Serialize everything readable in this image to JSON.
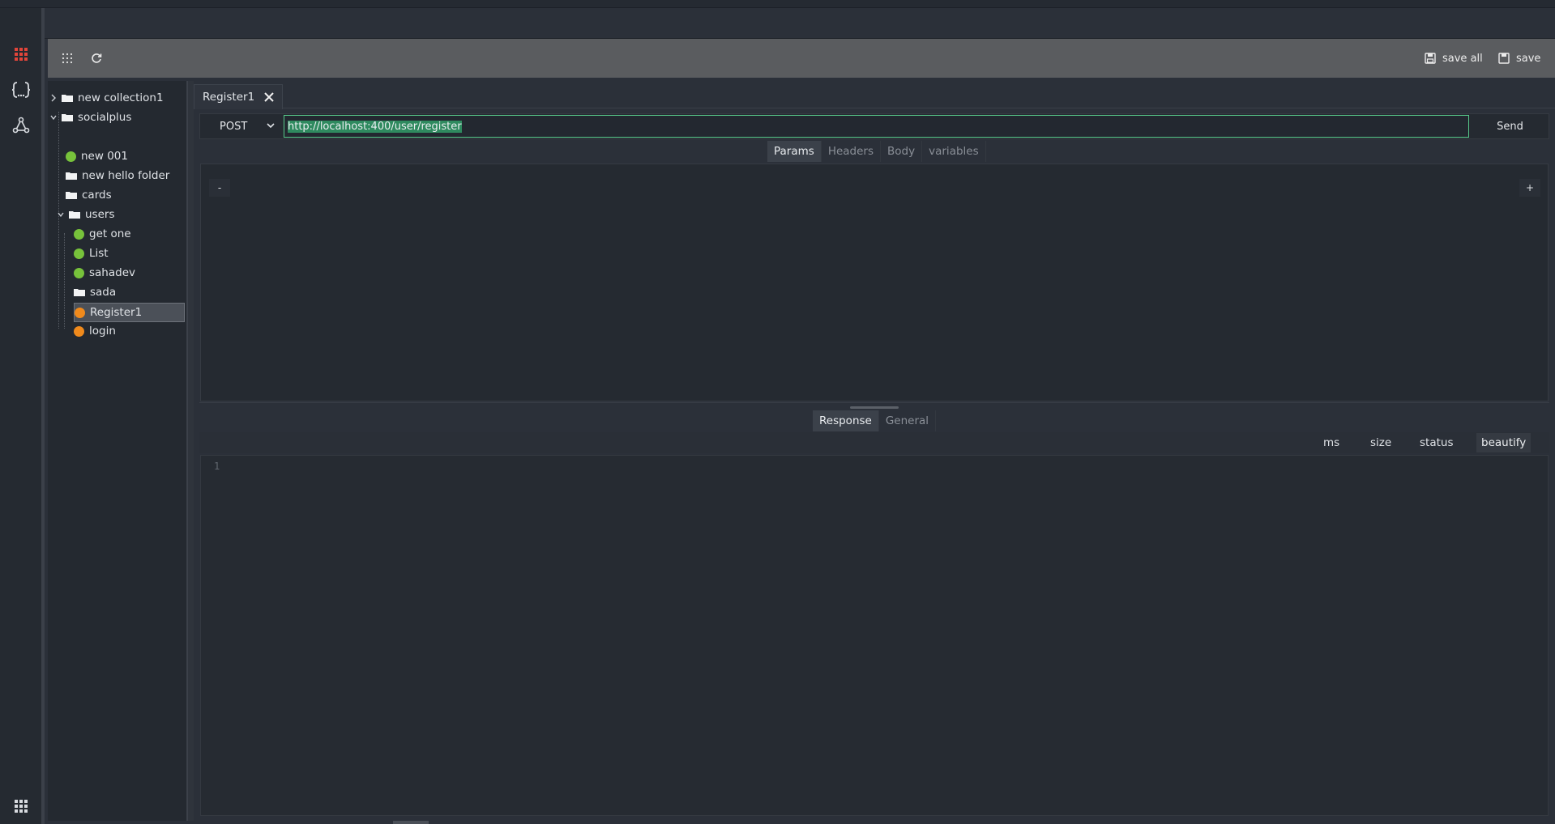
{
  "window": {
    "title": ""
  },
  "rail": {
    "items": [
      "grid-icon",
      "braces-icon",
      "network-icon"
    ],
    "bottom": "apps-icon",
    "accent": "#e2453a"
  },
  "toolbar": {
    "save_all_label": "save all",
    "save_label": "save"
  },
  "sidebar": {
    "items": [
      {
        "label": "new collection1",
        "type": "collection",
        "expanded": false
      },
      {
        "label": "socialplus",
        "type": "collection",
        "expanded": true
      },
      {
        "label": "new 001",
        "type": "request",
        "status": "green"
      },
      {
        "label": "new hello folder",
        "type": "folder"
      },
      {
        "label": "cards",
        "type": "folder"
      },
      {
        "label": "users",
        "type": "folder",
        "expanded": true
      },
      {
        "label": "get one",
        "type": "request",
        "status": "green"
      },
      {
        "label": "List",
        "type": "request",
        "status": "green"
      },
      {
        "label": "sahadev",
        "type": "request",
        "status": "green"
      },
      {
        "label": "sada",
        "type": "folder"
      },
      {
        "label": "Register1",
        "type": "request",
        "status": "orange",
        "selected": true
      },
      {
        "label": "login",
        "type": "request",
        "status": "orange"
      }
    ]
  },
  "tab": {
    "label": "Register1"
  },
  "request": {
    "method": "POST",
    "url": "http://localhost:400/user/register",
    "send_label": "Send",
    "tabs": [
      {
        "label": "Params",
        "active": true
      },
      {
        "label": "Headers",
        "active": false
      },
      {
        "label": "Body",
        "active": false
      },
      {
        "label": "variables",
        "active": false
      }
    ],
    "params": {
      "remove_label": "-",
      "add_label": "+"
    }
  },
  "response": {
    "tabs": [
      {
        "label": "Response",
        "active": true
      },
      {
        "label": "General",
        "active": false
      }
    ],
    "ms_label": "ms",
    "size_label": "size",
    "status_label": "status",
    "beautify_label": "beautify",
    "line_number": "1"
  },
  "colors": {
    "green": "#77c23b",
    "orange": "#f08a1c",
    "url_border": "#57c98a"
  }
}
